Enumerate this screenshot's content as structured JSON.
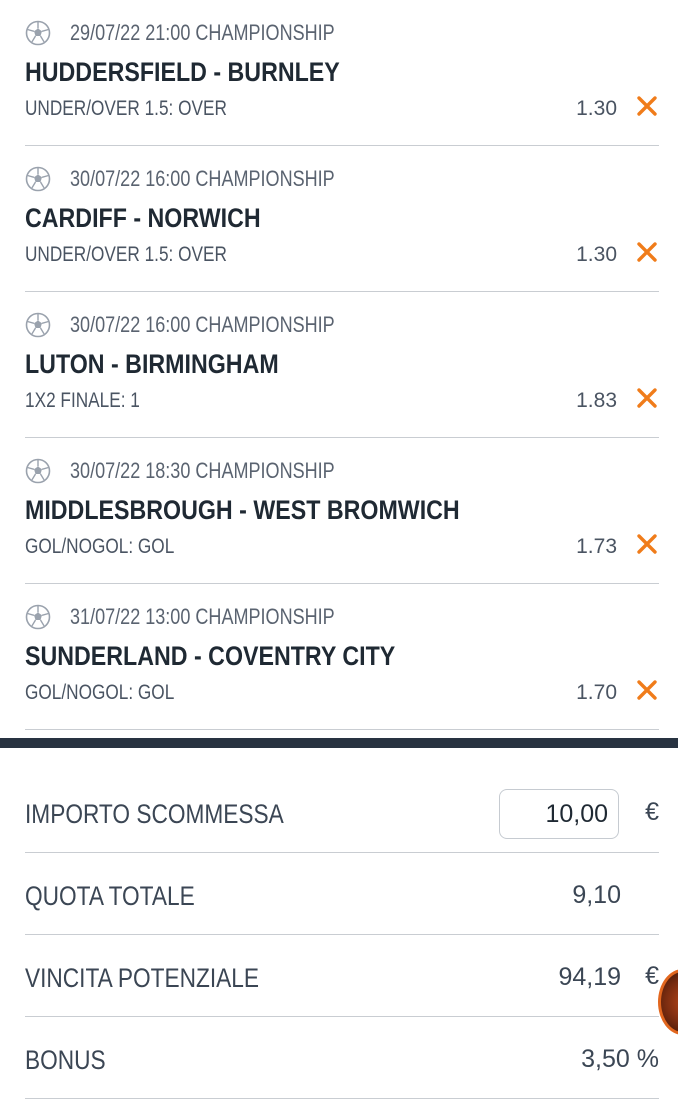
{
  "bets": [
    {
      "meta": "29/07/22 21:00 CHAMPIONSHIP",
      "teams": "HUDDERSFIELD - BURNLEY",
      "market": "UNDER/OVER 1.5: OVER",
      "odd": "1.30"
    },
    {
      "meta": "30/07/22 16:00 CHAMPIONSHIP",
      "teams": "CARDIFF - NORWICH",
      "market": "UNDER/OVER 1.5: OVER",
      "odd": "1.30"
    },
    {
      "meta": "30/07/22 16:00 CHAMPIONSHIP",
      "teams": "LUTON - BIRMINGHAM",
      "market": "1X2 FINALE: 1",
      "odd": "1.83"
    },
    {
      "meta": "30/07/22 18:30 CHAMPIONSHIP",
      "teams": "MIDDLESBROUGH - WEST BROMWICH",
      "market": "GOL/NOGOL: GOL",
      "odd": "1.73"
    },
    {
      "meta": "31/07/22 13:00 CHAMPIONSHIP",
      "teams": "SUNDERLAND - COVENTRY CITY",
      "market": "GOL/NOGOL: GOL",
      "odd": "1.70"
    }
  ],
  "summary": {
    "stake_label": "IMPORTO SCOMMESSA",
    "stake_value": "10,00",
    "stake_unit": "€",
    "total_odds_label": "QUOTA TOTALE",
    "total_odds_value": "9,10",
    "potential_win_label": "VINCITA POTENZIALE",
    "potential_win_value": "94,19",
    "potential_win_unit": "€",
    "bonus_label": "BONUS",
    "bonus_value": "3,50 %"
  },
  "icons": {
    "sport": "soccer-ball-icon",
    "remove": "close-icon",
    "chat": "chat-bubble-icon"
  },
  "colors": {
    "accent": "#f07c1a",
    "text_dark": "#1f2933",
    "text_muted": "#5a6370",
    "divider": "#283341"
  }
}
